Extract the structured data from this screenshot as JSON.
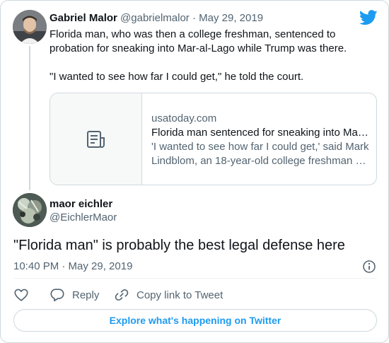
{
  "colors": {
    "accent": "#1d9bf0",
    "text": "#0f1419",
    "muted": "#536471",
    "border": "#cfd9de"
  },
  "parent_tweet": {
    "display_name": "Gabriel Malor",
    "handle": "@gabrielmalor",
    "separator": "·",
    "date": "May 29, 2019",
    "text_line1": "Florida man, who was then a college freshman, sentenced to",
    "text_line2": "probation for sneaking into Mar-al-Lago while Trump was there.",
    "text_line3": "\"I wanted to see how far I could get,\" he told the court.",
    "avatar_icon": "user-avatar-photo",
    "link_card": {
      "icon": "article-icon",
      "domain": "usatoday.com",
      "title": "Florida man sentenced for sneaking into Ma…",
      "description_line1": "'I wanted to see how far I could get,' said Mark",
      "description_line2": "Lindblom, an 18-year-old college freshman …"
    }
  },
  "main_tweet": {
    "display_name": "maor eichler",
    "handle": "@EichlerMaor",
    "avatar_icon": "user-avatar-photo",
    "text": "\"Florida man\" is probably the best legal defense here",
    "timestamp": "10:40 PM · May 29, 2019",
    "info_icon": "info-icon"
  },
  "actions": {
    "like_icon": "heart-icon",
    "reply_icon": "reply-icon",
    "reply_label": "Reply",
    "copy_icon": "link-icon",
    "copy_label": "Copy link to Tweet"
  },
  "footer": {
    "explore_label": "Explore what's happening on Twitter"
  },
  "brand": {
    "logo_icon": "twitter-bird-icon"
  }
}
